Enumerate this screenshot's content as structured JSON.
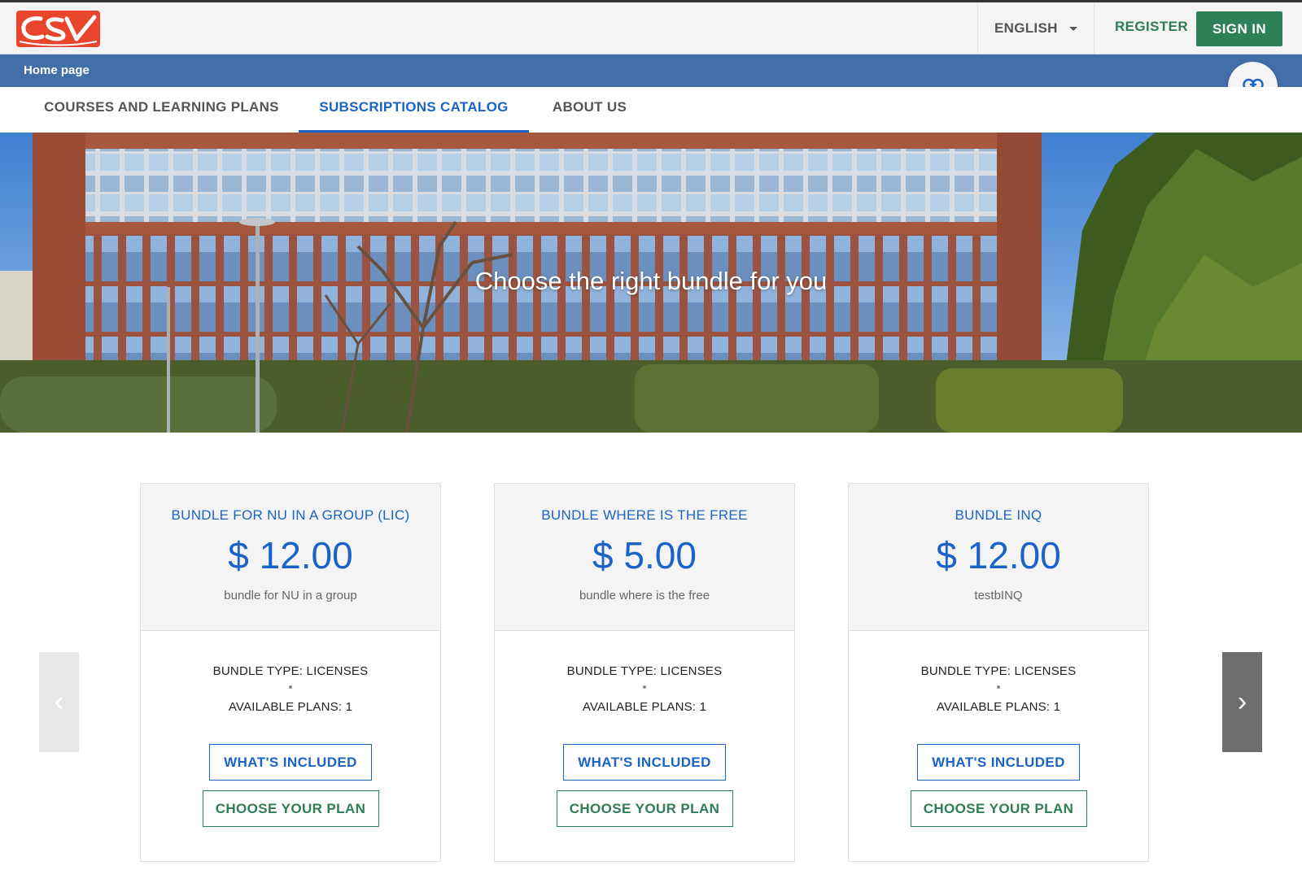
{
  "header": {
    "logo_text": "CSV",
    "language": "ENGLISH",
    "register_label": "REGISTER",
    "signin_label": "SIGN IN"
  },
  "breadcrumb": {
    "current": "Home page"
  },
  "tabs": [
    {
      "label": "COURSES AND LEARNING PLANS",
      "active": false
    },
    {
      "label": "SUBSCRIPTIONS CATALOG",
      "active": true
    },
    {
      "label": "ABOUT US",
      "active": false
    }
  ],
  "hero": {
    "title": "Choose the right bundle for you"
  },
  "bundles": [
    {
      "title": "BUNDLE FOR NU IN A GROUP (LIC)",
      "price": "$ 12.00",
      "description": "bundle for NU in a group",
      "type": "BUNDLE TYPE: LICENSES",
      "plans": "AVAILABLE PLANS: 1",
      "included_label": "WHAT'S INCLUDED",
      "choose_label": "CHOOSE YOUR PLAN"
    },
    {
      "title": "BUNDLE WHERE IS THE FREE",
      "price": "$ 5.00",
      "description": "bundle where is the free",
      "type": "BUNDLE TYPE: LICENSES",
      "plans": "AVAILABLE PLANS: 1",
      "included_label": "WHAT'S INCLUDED",
      "choose_label": "CHOOSE YOUR PLAN"
    },
    {
      "title": "BUNDLE INQ",
      "price": "$ 12.00",
      "description": "testbINQ",
      "type": "BUNDLE TYPE: LICENSES",
      "plans": "AVAILABLE PLANS: 1",
      "included_label": "WHAT'S INCLUDED",
      "choose_label": "CHOOSE YOUR PLAN"
    }
  ],
  "carousel": {
    "prev_glyph": "‹",
    "next_glyph": "›"
  },
  "colors": {
    "brand_blue": "#1a63c8",
    "brand_green": "#2e8059",
    "crumb_bar": "#436fa8",
    "logo_red": "#e8452c"
  },
  "icons": {
    "link": "link-icon",
    "caret": "caret-down-icon",
    "prev": "chevron-left-icon",
    "next": "chevron-right-icon"
  }
}
